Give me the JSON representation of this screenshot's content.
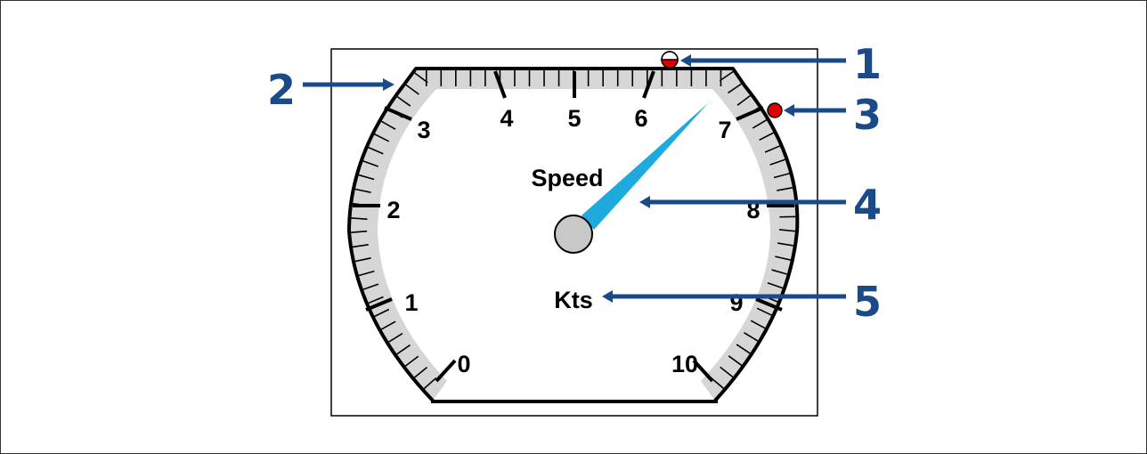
{
  "colors": {
    "callout": "#1a4a8a",
    "needle": "#1eaadc",
    "band": "#d6d6d6",
    "hub": "#c8c8c8",
    "alarm_red": "#e00000"
  },
  "gauge": {
    "title": "Speed",
    "unit": "Kts",
    "scale_min": 0,
    "scale_max": 10,
    "needle_value": 6.9,
    "tick_labels": [
      "0",
      "1",
      "2",
      "3",
      "4",
      "5",
      "6",
      "7",
      "8",
      "9",
      "10"
    ]
  },
  "callouts": [
    {
      "number": "1",
      "target": "half-filled-indicator-icon"
    },
    {
      "number": "2",
      "target": "scale-band"
    },
    {
      "number": "3",
      "target": "alarm-indicator-dot"
    },
    {
      "number": "4",
      "target": "needle"
    },
    {
      "number": "5",
      "target": "units-label"
    }
  ]
}
